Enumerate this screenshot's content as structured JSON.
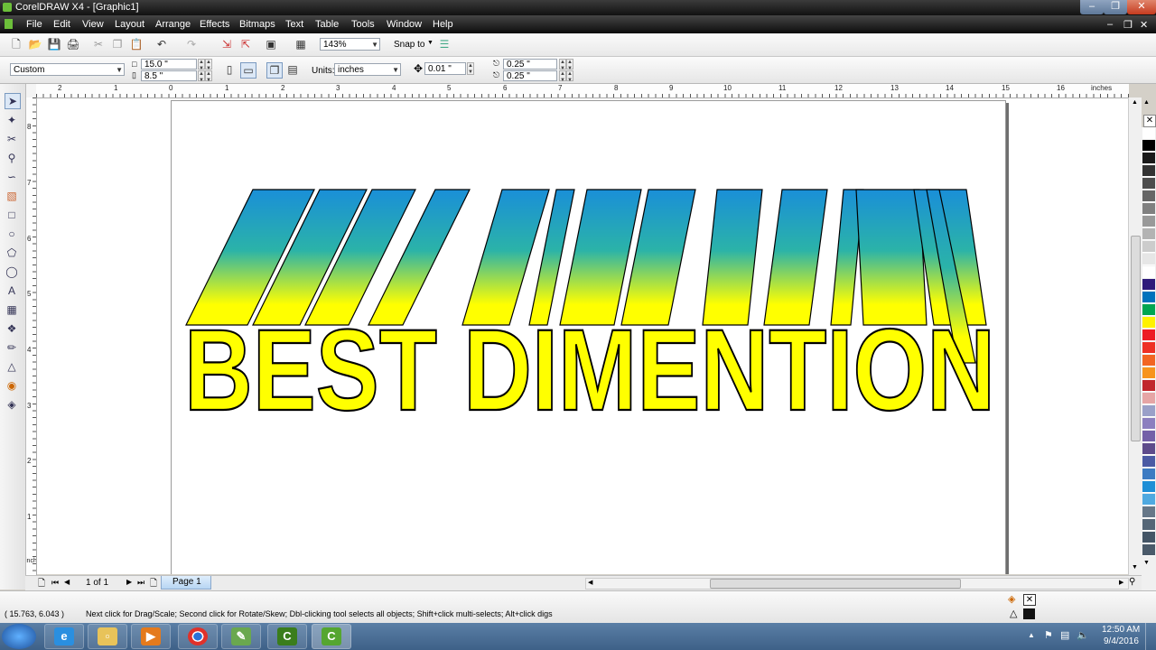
{
  "window": {
    "title": "CorelDRAW X4 - [Graphic1]"
  },
  "menu": [
    "File",
    "Edit",
    "View",
    "Layout",
    "Arrange",
    "Effects",
    "Bitmaps",
    "Text",
    "Table",
    "Tools",
    "Window",
    "Help"
  ],
  "toolbar": {
    "zoom": "143%",
    "snap_to": "Snap to"
  },
  "property_bar": {
    "page_preset": "Custom",
    "width": "15.0 \"",
    "height": "8.5 \"",
    "units_label": "Units:",
    "units_value": "inches",
    "nudge": "0.01 \"",
    "dup_x": "0.25 \"",
    "dup_y": "0.25 \""
  },
  "ruler": {
    "unit": "inches",
    "h_labels": [
      "2",
      "1",
      "0",
      "1",
      "2",
      "3",
      "4",
      "5",
      "6",
      "7",
      "8",
      "9",
      "10",
      "11",
      "12",
      "13",
      "14",
      "15",
      "16"
    ],
    "v_labels": [
      "8",
      "7",
      "6",
      "5",
      "4",
      "3",
      "2",
      "1"
    ],
    "v_unit": "inches"
  },
  "artwork": {
    "text": "BEST DIMENTION",
    "front_color": "#ffff00",
    "extrude_top_color": "#1a8fd8",
    "extrude_mid_color": "#2bb3a8"
  },
  "pagebar": {
    "page_count": "1 of 1",
    "tab": "Page 1"
  },
  "status": {
    "coords": "( 15.763, 6.043 )",
    "hint": "Next click for Drag/Scale; Second click for Rotate/Skew; Dbl-clicking tool selects all objects; Shift+click multi-selects; Alt+click digs"
  },
  "taskbar": {
    "time": "12:50 AM",
    "date": "9/4/2016"
  },
  "palette": [
    "#ffffff",
    "#000000",
    "#1a1a1a",
    "#333333",
    "#4d4d4d",
    "#666666",
    "#808080",
    "#999999",
    "#b3b3b3",
    "#cccccc",
    "#e6e6e6",
    "#ffffff",
    "#2e1a7a",
    "#0072bc",
    "#00a651",
    "#fff200",
    "#ed1c24",
    "#ee3124",
    "#f26522",
    "#f7941d",
    "#c1272d",
    "#e6a5a5",
    "#9aa0c8",
    "#8c7fbf",
    "#7460a8",
    "#5e4b8b",
    "#4b5aa4",
    "#3d7bc2",
    "#1f8fd6",
    "#4fa9e0",
    "#667788",
    "#556677",
    "#445566",
    "#4a5a6a"
  ]
}
